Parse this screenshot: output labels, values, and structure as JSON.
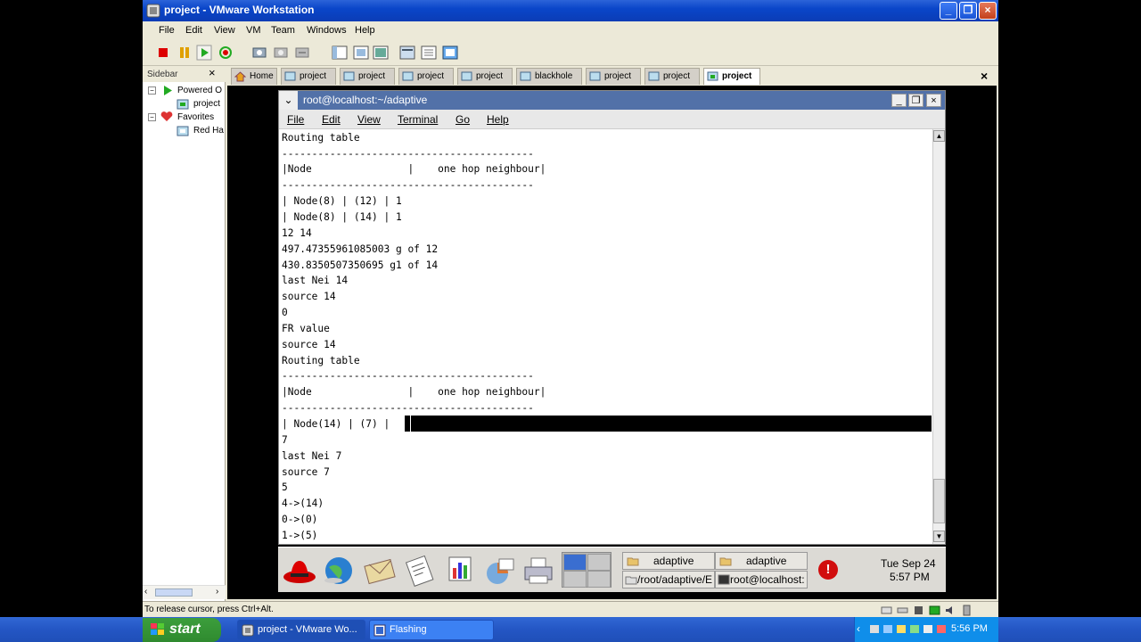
{
  "vmware": {
    "title": "project - VMware Workstation",
    "menu": [
      "File",
      "Edit",
      "View",
      "VM",
      "Team",
      "Windows",
      "Help"
    ],
    "sidebar": {
      "header": "Sidebar",
      "close": "×",
      "items": [
        "Powered O",
        "project",
        "Favorites",
        "Red Ha"
      ]
    },
    "tabs": [
      "Home",
      "project",
      "project",
      "project",
      "project",
      "blackhole",
      "project",
      "project",
      "project"
    ],
    "tab_close": "×",
    "status_text": "To release cursor, press Ctrl+Alt."
  },
  "terminal": {
    "title": "root@localhost:~/adaptive",
    "menu": [
      "File",
      "Edit",
      "View",
      "Terminal",
      "Go",
      "Help"
    ],
    "lines": [
      "Routing table",
      "------------------------------------------",
      "|Node                |    one hop neighbour|",
      "------------------------------------------",
      "| Node(8) | (12) | 1",
      "| Node(8) | (14) | 1",
      "12 14",
      "497.47355961085003 g of 12",
      "430.8350507350695 g1 of 14",
      "last Nei 14",
      "source 14",
      "0",
      "FR value",
      "source 14",
      "Routing table",
      "------------------------------------------",
      "|Node                |    one hop neighbour|",
      "------------------------------------------",
      "| Node(14) | (7) |",
      "7",
      "last Nei 7",
      "source 7",
      "5",
      "4->(14)",
      "0->(0)",
      "1->(5)"
    ]
  },
  "gnome_panel": {
    "tasks_top": [
      "adaptive",
      "adaptive"
    ],
    "tasks_bottom": [
      "/root/adaptive/E",
      "root@localhost:"
    ],
    "alert": "!",
    "date": "Tue Sep 24",
    "time": "5:57 PM"
  },
  "taskbar": {
    "start": "start",
    "buttons": [
      "project - VMware Wo...",
      "Flashing"
    ],
    "clock": "5:56 PM"
  }
}
